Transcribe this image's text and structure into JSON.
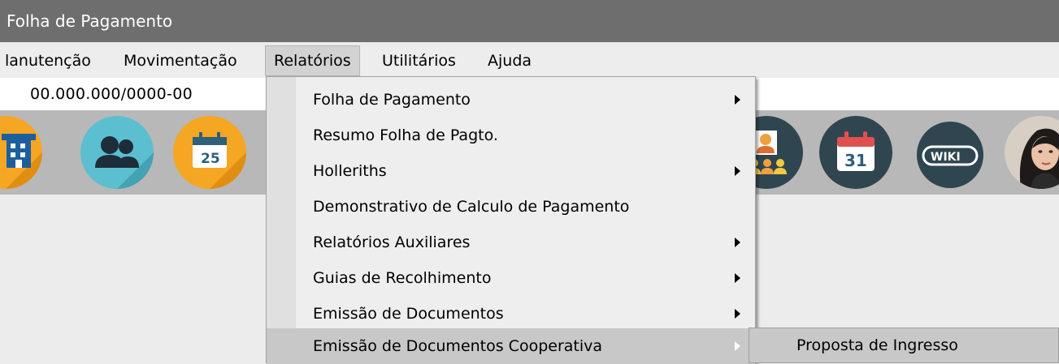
{
  "window": {
    "title": "Folha de Pagamento"
  },
  "menubar": {
    "items": [
      {
        "label": "lanutenção"
      },
      {
        "label": "Movimentação"
      },
      {
        "label": "Relatórios"
      },
      {
        "label": "Utilitários"
      },
      {
        "label": "Ajuda"
      }
    ],
    "active": "Relatórios"
  },
  "company": {
    "cnpj": "00.000.000/0000-00"
  },
  "toolbar": {
    "icons": [
      {
        "name": "building-icon"
      },
      {
        "name": "users-icon"
      },
      {
        "name": "calendar-25-icon"
      },
      {
        "name": "people-portrait-icon"
      },
      {
        "name": "calendar-31-icon",
        "text": "31"
      },
      {
        "name": "wiki-icon",
        "text": "WIKI"
      },
      {
        "name": "assistant-avatar"
      }
    ],
    "calendar_small_day": "25"
  },
  "dropdown": {
    "items": [
      {
        "label": "Folha de Pagamento",
        "submenu": true
      },
      {
        "label": "Resumo Folha de Pagto.",
        "submenu": false
      },
      {
        "label": "Holleriths",
        "submenu": true
      },
      {
        "label": "Demonstrativo de Calculo de Pagamento",
        "submenu": false
      },
      {
        "label": "Relatórios Auxiliares",
        "submenu": true
      },
      {
        "label": "Guias de Recolhimento",
        "submenu": true
      },
      {
        "label": "Emissão de Documentos",
        "submenu": true
      },
      {
        "label": "Emissão de Documentos Cooperativa",
        "submenu": true
      }
    ],
    "highlighted_index": 7
  },
  "submenu": {
    "items": [
      {
        "label": "Proposta de Ingresso"
      }
    ]
  },
  "colors": {
    "titlebar": "#6e6e6e",
    "toolbar": "#b8b8b8",
    "icon_orange": "#f5a623",
    "icon_teal": "#5bbfcf",
    "icon_dark": "#2f4650",
    "highlight": "#c8c8c8"
  }
}
